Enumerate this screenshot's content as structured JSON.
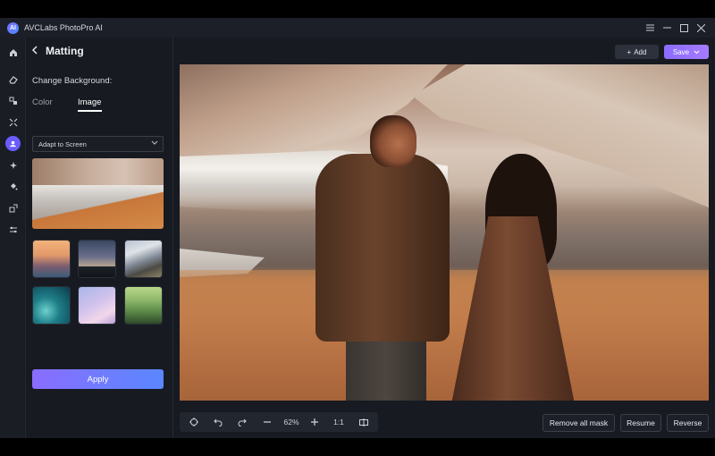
{
  "window": {
    "logo_text": "AI",
    "title": "AVCLabs PhotoPro AI",
    "controls": [
      "menu-icon",
      "minimize-icon",
      "maximize-icon",
      "close-icon"
    ]
  },
  "iconbar": {
    "items": [
      "home-icon",
      "eraser-icon",
      "enhance-icon",
      "expand-icon",
      "matting-icon",
      "colorize-icon",
      "fill-icon",
      "replace-icon",
      "adjust-icon"
    ],
    "active": "matting-icon"
  },
  "panel": {
    "title": "Matting",
    "section_label": "Change Background:",
    "tabs": {
      "color": "Color",
      "image": "Image",
      "active": "Image"
    },
    "select": {
      "value": "Adapt to Screen"
    },
    "apply_label": "Apply"
  },
  "header": {
    "add_label": "Add",
    "save_label": "Save"
  },
  "toolbar": {
    "zoom": "62%",
    "ratio": "1:1",
    "remove_all_mask": "Remove all mask",
    "resume": "Resume",
    "reverse": "Reverse"
  },
  "colors": {
    "accent": "#6a5cff",
    "apply_gradient_start": "#8a6cff",
    "apply_gradient_end": "#5a86ff",
    "background": "#171a21"
  }
}
